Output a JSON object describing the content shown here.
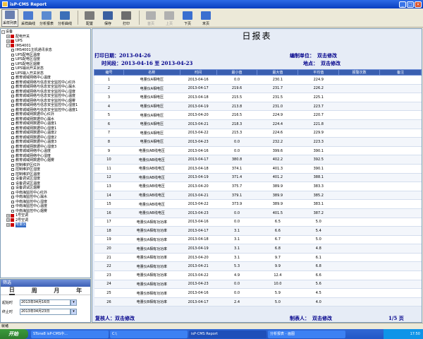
{
  "window": {
    "title": "isP-CMS Report"
  },
  "toolbar": [
    {
      "label": "采样列表",
      "icon": "list-icon",
      "color": "#6a7fb0",
      "state": "pressed"
    },
    {
      "label": "采样曲线",
      "icon": "curve-icon",
      "color": "#4a7bd0",
      "state": "normal"
    },
    {
      "label": "分析报表",
      "icon": "report-icon",
      "color": "#5b8bd0",
      "state": "normal"
    },
    {
      "label": "分析曲线",
      "icon": "chart-icon",
      "color": "#3c6fb8",
      "state": "normal"
    },
    {
      "label": "配置",
      "icon": "config-icon",
      "color": "#7a7a7a",
      "state": "normal"
    },
    {
      "label": "保存",
      "icon": "save-icon",
      "color": "#3a5fa0",
      "state": "normal"
    },
    {
      "label": "打印",
      "icon": "print-icon",
      "color": "#6d6d6d",
      "state": "normal"
    },
    {
      "label": "首页",
      "icon": "first-page-icon",
      "color": "#b0b0b0",
      "state": "disabled"
    },
    {
      "label": "上页",
      "icon": "prev-page-icon",
      "color": "#b0b0b0",
      "state": "disabled"
    },
    {
      "label": "下页",
      "icon": "next-page-icon",
      "color": "#3a6fd0",
      "state": "normal"
    },
    {
      "label": "末页",
      "icon": "last-page-icon",
      "color": "#3a6fd0",
      "state": "normal"
    }
  ],
  "tree": [
    {
      "level": 0,
      "label": "设备",
      "exp": "-",
      "icon": "none"
    },
    {
      "level": 1,
      "label": "配电开关",
      "exp": "+",
      "icon": "folder"
    },
    {
      "level": 1,
      "label": "UPS",
      "exp": "+",
      "icon": "folder"
    },
    {
      "level": 1,
      "label": "IMS4001",
      "exp": "-",
      "icon": "folder"
    },
    {
      "level": 2,
      "label": "IMS4001主机通讯状态",
      "exp": "",
      "icon": "leaf"
    },
    {
      "level": 2,
      "label": "UPS配电区温度",
      "exp": "",
      "icon": "leaf"
    },
    {
      "level": 2,
      "label": "UPS配电区湿度",
      "exp": "",
      "icon": "leaf"
    },
    {
      "level": 2,
      "label": "UPS配电区烟雾",
      "exp": "",
      "icon": "leaf"
    },
    {
      "level": 2,
      "label": "UPS输出开关状态",
      "exp": "",
      "icon": "leaf"
    },
    {
      "level": 2,
      "label": "UPS输入开关状态",
      "exp": "",
      "icon": "leaf"
    },
    {
      "level": 2,
      "label": "教育城域网络中心温度",
      "exp": "",
      "icon": "leaf"
    },
    {
      "level": 2,
      "label": "教育城域网络与信息安全监控中心红外",
      "exp": "",
      "icon": "leaf"
    },
    {
      "level": 2,
      "label": "教育城域网络与信息安全监控中心漏水",
      "exp": "",
      "icon": "leaf"
    },
    {
      "level": 2,
      "label": "教育城域网络与信息安全监控中心湿度",
      "exp": "",
      "icon": "leaf"
    },
    {
      "level": 2,
      "label": "教育城域网络与信息安全监控中心温度",
      "exp": "",
      "icon": "leaf"
    },
    {
      "level": 2,
      "label": "教育城域网络与信息安全监控中心烟雾",
      "exp": "",
      "icon": "leaf"
    },
    {
      "level": 2,
      "label": "教育城域网络与信息安全监控中心湿度1",
      "exp": "",
      "icon": "leaf"
    },
    {
      "level": 2,
      "label": "教育城域网络与信息安全监控中心温度1",
      "exp": "",
      "icon": "leaf"
    },
    {
      "level": 2,
      "label": "教育城域网数据中心红外",
      "exp": "",
      "icon": "leaf"
    },
    {
      "level": 2,
      "label": "教育城域网数据中心漏水",
      "exp": "",
      "icon": "leaf"
    },
    {
      "level": 2,
      "label": "教育城域网数据中心温度1",
      "exp": "",
      "icon": "leaf"
    },
    {
      "level": 2,
      "label": "教育城域网数据中心湿度1",
      "exp": "",
      "icon": "leaf"
    },
    {
      "level": 2,
      "label": "教育城域网数据中心温度2",
      "exp": "",
      "icon": "leaf"
    },
    {
      "level": 2,
      "label": "教育城域网数据中心湿度2",
      "exp": "",
      "icon": "leaf"
    },
    {
      "level": 2,
      "label": "教育城域网数据中心温度3",
      "exp": "",
      "icon": "leaf"
    },
    {
      "level": 2,
      "label": "教育城域网数据中心湿度3",
      "exp": "",
      "icon": "leaf"
    },
    {
      "level": 2,
      "label": "教育城域网络中心温度",
      "exp": "",
      "icon": "leaf"
    },
    {
      "level": 2,
      "label": "教育城域网络中心湿度",
      "exp": "",
      "icon": "leaf"
    },
    {
      "level": 2,
      "label": "教育城域网数据中心烟雾",
      "exp": "",
      "icon": "leaf"
    },
    {
      "level": 2,
      "label": "控制维护区红外",
      "exp": "",
      "icon": "leaf"
    },
    {
      "level": 2,
      "label": "控制维护区湿度",
      "exp": "",
      "icon": "leaf"
    },
    {
      "level": 2,
      "label": "控制维护区温度",
      "exp": "",
      "icon": "leaf"
    },
    {
      "level": 2,
      "label": "设备调试区湿度",
      "exp": "",
      "icon": "leaf"
    },
    {
      "level": 2,
      "label": "设备调试区温度",
      "exp": "",
      "icon": "leaf"
    },
    {
      "level": 2,
      "label": "设备调试区烟雾",
      "exp": "",
      "icon": "leaf"
    },
    {
      "level": 2,
      "label": "中南海监控中心红外",
      "exp": "",
      "icon": "leaf"
    },
    {
      "level": 2,
      "label": "中南海监控中心漏水",
      "exp": "",
      "icon": "leaf"
    },
    {
      "level": 2,
      "label": "中南海监控中心湿度",
      "exp": "",
      "icon": "leaf"
    },
    {
      "level": 2,
      "label": "中南海监控中心温度",
      "exp": "",
      "icon": "leaf"
    },
    {
      "level": 2,
      "label": "中南海监控中心烟雾",
      "exp": "",
      "icon": "leaf"
    },
    {
      "level": 1,
      "label": "1号空调",
      "exp": "+",
      "icon": "folder"
    },
    {
      "level": 1,
      "label": "2号空调",
      "exp": "+",
      "icon": "folder"
    },
    {
      "level": 1,
      "label": "电量仪",
      "exp": "+",
      "icon": "folder",
      "selected": true
    }
  ],
  "filter": {
    "header": "筛选",
    "tabs": [
      "日",
      "周",
      "月",
      "年"
    ],
    "active_tab": 0,
    "start_label": "起始时",
    "start_value": "2013年04月16日",
    "end_label": "终止时",
    "end_value": "2013年04月23日"
  },
  "report": {
    "title": "日报表",
    "print_date_label": "打印日期：",
    "print_date": "2013-04-26",
    "period_label": "时间段：",
    "period": "2013-04-16 至 2013-04-23",
    "unit_label": "编制单位：",
    "unit_value": "双击修改",
    "place_label": "地点：",
    "place_value": "双击修改",
    "columns": [
      "编号",
      "名称",
      "时间",
      "最小值",
      "最大值",
      "平均值",
      "报警次数",
      "备注"
    ],
    "rows": [
      [
        "1",
        "电量仪A相电压",
        "2013-04-16",
        "0.0",
        "230.1",
        "224.9",
        "",
        ""
      ],
      [
        "2",
        "电量仪A相电压",
        "2013-04-17",
        "219.6",
        "231.7",
        "226.2",
        "",
        ""
      ],
      [
        "3",
        "电量仪A相电压",
        "2013-04-18",
        "215.5",
        "231.5",
        "225.1",
        "",
        ""
      ],
      [
        "4",
        "电量仪A相电压",
        "2013-04-19",
        "213.8",
        "231.0",
        "223.7",
        "",
        ""
      ],
      [
        "5",
        "电量仪A相电压",
        "2013-04-20",
        "216.5",
        "224.9",
        "220.7",
        "",
        ""
      ],
      [
        "6",
        "电量仪A相电压",
        "2013-04-21",
        "218.3",
        "224.4",
        "221.8",
        "",
        ""
      ],
      [
        "7",
        "电量仪A相电压",
        "2013-04-22",
        "215.3",
        "224.6",
        "229.9",
        "",
        ""
      ],
      [
        "8",
        "电量仪A相电压",
        "2013-04-23",
        "0.0",
        "232.2",
        "223.3",
        "",
        ""
      ],
      [
        "9",
        "电量仪AB线电压",
        "2013-04-16",
        "0.0",
        "399.6",
        "390.1",
        "",
        ""
      ],
      [
        "10",
        "电量仪AB线电压",
        "2013-04-17",
        "380.8",
        "402.2",
        "392.5",
        "",
        ""
      ],
      [
        "11",
        "电量仪AB线电压",
        "2013-04-18",
        "374.1",
        "401.3",
        "390.1",
        "",
        ""
      ],
      [
        "12",
        "电量仪AB线电压",
        "2013-04-19",
        "371.4",
        "401.2",
        "388.1",
        "",
        ""
      ],
      [
        "13",
        "电量仪AB线电压",
        "2013-04-20",
        "375.7",
        "389.9",
        "383.3",
        "",
        ""
      ],
      [
        "14",
        "电量仪AB线电压",
        "2013-04-21",
        "379.1",
        "389.9",
        "385.2",
        "",
        ""
      ],
      [
        "15",
        "电量仪AB线电压",
        "2013-04-22",
        "373.9",
        "389.9",
        "383.1",
        "",
        ""
      ],
      [
        "16",
        "电量仪AB线电压",
        "2013-04-23",
        "0.0",
        "401.5",
        "387.2",
        "",
        ""
      ],
      [
        "17",
        "电量仪A相有功功率",
        "2013-04-16",
        "0.0",
        "6.5",
        "5.0",
        "",
        ""
      ],
      [
        "18",
        "电量仪A相有功功率",
        "2013-04-17",
        "3.1",
        "6.6",
        "5.4",
        "",
        ""
      ],
      [
        "19",
        "电量仪A相有功功率",
        "2013-04-18",
        "3.1",
        "6.7",
        "5.0",
        "",
        ""
      ],
      [
        "20",
        "电量仪A相有功功率",
        "2013-04-19",
        "3.1",
        "6.8",
        "4.8",
        "",
        ""
      ],
      [
        "21",
        "电量仪A相有功功率",
        "2013-04-20",
        "3.1",
        "9.7",
        "6.1",
        "",
        ""
      ],
      [
        "22",
        "电量仪A相有功功率",
        "2013-04-21",
        "5.3",
        "9.9",
        "6.8",
        "",
        ""
      ],
      [
        "23",
        "电量仪A相有功功率",
        "2013-04-22",
        "4.9",
        "12.4",
        "6.6",
        "",
        ""
      ],
      [
        "24",
        "电量仪A相有功功率",
        "2013-04-23",
        "0.0",
        "10.0",
        "5.6",
        "",
        ""
      ],
      [
        "25",
        "电量仪B相有功功率",
        "2013-04-16",
        "0.0",
        "5.9",
        "4.5",
        "",
        ""
      ],
      [
        "26",
        "电量仪B相有功功率",
        "2013-04-17",
        "2.4",
        "5.0",
        "4.0",
        "",
        ""
      ]
    ],
    "reviewer_label": "复核人：",
    "reviewer_value": "双击修改",
    "preparer_label": "制表人：",
    "preparer_value": "双击修改",
    "page_info": "1/5 页"
  },
  "statusbar": {
    "text": "就绪"
  },
  "taskbar": {
    "start_label": "开始",
    "tasks": [
      {
        "label": "STone8 isP-CMS中...",
        "active": false
      },
      {
        "label": "C:\\",
        "active": false
      },
      {
        "label": "isP-CMS Report",
        "active": true
      },
      {
        "label": "分析报表 - 画图",
        "active": false
      }
    ],
    "clock": "17:50"
  }
}
